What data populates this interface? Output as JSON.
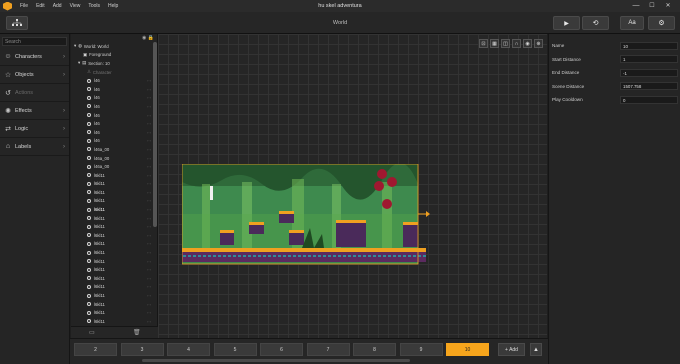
{
  "menu": {
    "items": [
      "File",
      "Edit",
      "Add",
      "View",
      "Tools",
      "Help"
    ]
  },
  "window": {
    "title": "hu skel adventura",
    "minimize": "—",
    "maximize": "☐",
    "close": "✕"
  },
  "toolbar": {
    "center_label": "World",
    "play_icon": "▶",
    "replay_icon": "⟲",
    "font_label": "Aa",
    "settings_icon": "⚙"
  },
  "sidebar": {
    "search_placeholder": "Search",
    "categories": [
      {
        "label": "Characters",
        "icon": "☺"
      },
      {
        "label": "Objects",
        "icon": "☆"
      },
      {
        "label": "Actions",
        "icon": "↺"
      },
      {
        "label": "Effects",
        "icon": "✺"
      },
      {
        "label": "Logic",
        "icon": "⇄"
      },
      {
        "label": "Labels",
        "icon": "⌂"
      }
    ]
  },
  "tree": {
    "header": "◉ 🔒",
    "world": "World: World",
    "foreground": "Foreground",
    "section": "Section: 10",
    "character": "Character",
    "items": [
      "l46",
      "l46",
      "l46",
      "l46",
      "l46",
      "l46",
      "l46",
      "l46",
      "l46a_00",
      "l46a_00",
      "l46a_00",
      "l6kl11",
      "l6kl11",
      "l6kl11",
      "l6kl11",
      "l6kl11",
      "l6kl11",
      "l6kl11",
      "l6kl11",
      "l6kl11",
      "l6kl11",
      "l6kl11",
      "l6kl11",
      "l6kl11",
      "l6kl11",
      "l6kl11",
      "l6kl11",
      "l6kl11",
      "l6kl11"
    ],
    "selected_index": 15
  },
  "properties": [
    {
      "label": "Name",
      "value": "10"
    },
    {
      "label": "Start Distance",
      "value": "1"
    },
    {
      "label": "End Distance",
      "value": "-1"
    },
    {
      "label": "Scene Distance",
      "value": "1507.758"
    },
    {
      "label": "Play Cooldown",
      "value": "0"
    }
  ],
  "pages": {
    "items": [
      "2",
      "3",
      "4",
      "5",
      "6",
      "7",
      "8",
      "9",
      "10"
    ],
    "active_index": 8
  },
  "bottom": {
    "add_label": "+ Add",
    "up_icon": "▲"
  },
  "colors": {
    "accent": "#f7a51c",
    "grass": "#6cbe45",
    "sky": "#3f8f4f",
    "soil": "#5b2a5f"
  }
}
